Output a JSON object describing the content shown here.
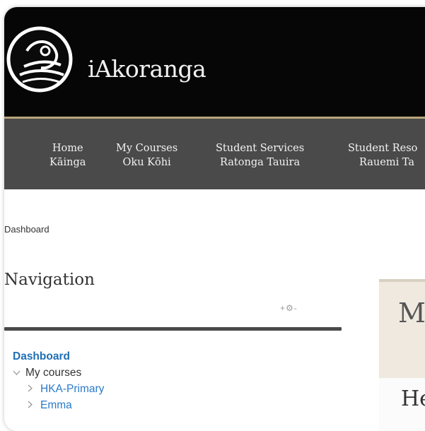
{
  "site": {
    "title": "iAkoranga"
  },
  "nav": [
    {
      "line1": "Home",
      "line2": "Kāinga"
    },
    {
      "line1": "My Courses",
      "line2": "Oku Kōhi"
    },
    {
      "line1": "Student Services",
      "line2": "Ratonga Tauira"
    },
    {
      "line1": "Student Reso",
      "line2": "Rauemi Ta"
    }
  ],
  "breadcrumb": "Dashboard",
  "navigation_block": {
    "title": "Navigation",
    "controls": "+⚙-",
    "root": "Dashboard",
    "my_courses": "My courses",
    "courses": [
      "HKA-Primary",
      "Emma"
    ]
  },
  "main": {
    "box_letter": "M",
    "panel_letter": "He"
  },
  "icons": {
    "expanded": "chevron-down-icon",
    "collapsed": "chevron-right-icon"
  },
  "colors": {
    "header_bg": "#060606",
    "nav_bg": "#4a4a4a",
    "accent_gold": "#b8a57a",
    "link_blue": "#2a7ac8"
  }
}
